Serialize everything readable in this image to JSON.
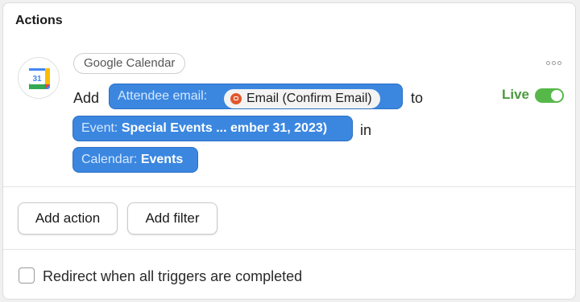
{
  "section": {
    "title": "Actions"
  },
  "action": {
    "app_name": "Google Calendar",
    "app_logo_text": "31",
    "app_logo_icon": "google-calendar-icon",
    "more_icon": "more-options-icon",
    "verb": "Add",
    "attendee_token": {
      "key": "Attendee email:",
      "chip_icon": "form-icon",
      "chip_value": "Email (Confirm Email)"
    },
    "to_word": "to",
    "event_token": {
      "key": "Event:",
      "value": "Special Events ... ember 31, 2023)"
    },
    "in_word": "in",
    "calendar_token": {
      "key": "Calendar:",
      "value": "Events"
    },
    "status": {
      "label": "Live",
      "enabled": true,
      "color": "#4b9a3e"
    }
  },
  "buttons": {
    "add_action": "Add action",
    "add_filter": "Add filter"
  },
  "redirect": {
    "label": "Redirect when all triggers are completed",
    "checked": false
  },
  "colors": {
    "token_blue": "#3b87e0",
    "toggle_green": "#57b84a"
  }
}
